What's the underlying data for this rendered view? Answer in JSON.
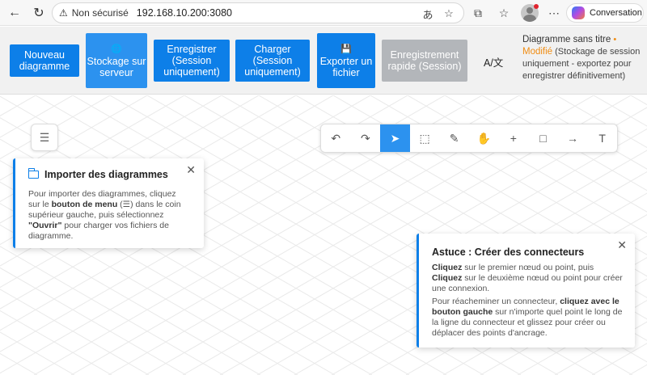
{
  "browser": {
    "back_icon": "arrow-left-icon",
    "reload_icon": "reload-icon",
    "security_label": "Non sécurisé",
    "url": "192.168.10.200:3080",
    "conversation_label": "Conversation"
  },
  "toolbar": {
    "new_diagram": "Nouveau diagramme",
    "server_storage": "Stockage sur serveur",
    "save_session": "Enregistrer (Session uniquement)",
    "load_session": "Charger (Session uniquement)",
    "export_file": "Exporter un fichier",
    "quick_save": "Enregistrement rapide (Session)",
    "language": "A/文"
  },
  "status": {
    "title": "Diagramme sans titre",
    "dot": "•",
    "modified": "Modifié",
    "note": "(Stockage de session uniquement - exportez pour enregistrer définitivement)"
  },
  "tools": [
    {
      "name": "undo",
      "glyph": "↶"
    },
    {
      "name": "redo",
      "glyph": "↷"
    },
    {
      "name": "select",
      "glyph": "➤"
    },
    {
      "name": "lasso",
      "glyph": "⬚"
    },
    {
      "name": "freehand",
      "glyph": "✎"
    },
    {
      "name": "pan",
      "glyph": "✋"
    },
    {
      "name": "add-node",
      "glyph": "+"
    },
    {
      "name": "rectangle",
      "glyph": "□"
    },
    {
      "name": "connector",
      "glyph": "→"
    },
    {
      "name": "text",
      "glyph": "T"
    }
  ],
  "import_card": {
    "title": "Importer des diagrammes",
    "t1": "Pour importer des diagrammes, cliquez sur le ",
    "b1": "bouton de menu",
    "t2": " (☰) dans le coin supérieur gauche, puis sélectionnez ",
    "b2": "\"Ouvrir\"",
    "t3": " pour charger vos fichiers de diagramme."
  },
  "tip_card": {
    "title": "Astuce : Créer des connecteurs",
    "p1_b1": "Cliquez",
    "p1_t1": " sur le premier nœud ou point, puis ",
    "p1_b2": "Cliquez",
    "p1_t2": " sur le deuxième nœud ou point pour créer une connexion.",
    "p2_t1": "Pour réacheminer un connecteur, ",
    "p2_b1": "cliquez avec le bouton gauche",
    "p2_t2": " sur n'importe quel point le long de la ligne du connecteur et glissez pour créer ou déplacer des points d'ancrage."
  },
  "colors": {
    "primary": "#0d7fe8",
    "disabled": "#b3b6ba",
    "modified": "#f08c12"
  }
}
